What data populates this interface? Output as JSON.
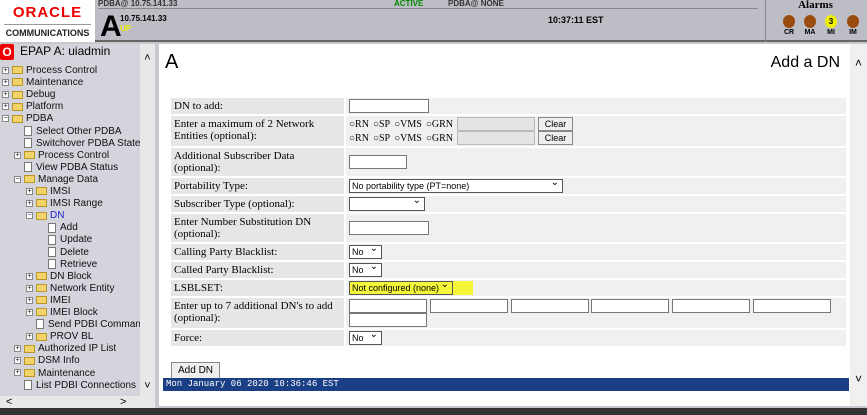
{
  "header": {
    "strip_left": "PDBA@ 10.75.141.33",
    "strip_status": "ACTIVE",
    "strip_right": "PDBA@ NONE",
    "logo_top": "ORACLE",
    "logo_bottom": "COMMUNICATIONS",
    "server": "A",
    "ip": "10.75.141.33",
    "state": "UP",
    "time": "10:37:11 EST"
  },
  "alarms": {
    "title": "Alarms",
    "items": [
      {
        "label": "CR",
        "count": ""
      },
      {
        "label": "MA",
        "count": ""
      },
      {
        "label": "MI",
        "count": "3"
      },
      {
        "label": "IM",
        "count": ""
      }
    ]
  },
  "sidebar": {
    "user": "EPAP A: uiadmin",
    "items": [
      "Process Control",
      "Maintenance",
      "Debug",
      "Platform",
      "PDBA",
      "Select Other PDBA",
      "Switchover PDBA State",
      "Process Control",
      "View PDBA Status",
      "Manage Data",
      "IMSI",
      "IMSI Range",
      "DN",
      "Add",
      "Update",
      "Delete",
      "Retrieve",
      "DN Block",
      "Network Entity",
      "IMEI",
      "IMEI Block",
      "Send PDBI Command",
      "PROV BL",
      "Authorized IP List",
      "DSM Info",
      "Maintenance",
      "List PDBI Connections"
    ]
  },
  "main": {
    "title": "A",
    "subtitle": "Add a DN",
    "labels": {
      "dn": "DN to add:",
      "ne": "Enter a maximum of 2 Network Entities (optional):",
      "asd": "Additional Subscriber Data (optional):",
      "pt": "Portability Type:",
      "st": "Subscriber Type (optional):",
      "nsdn": "Enter Number Substitution DN (optional):",
      "cgbl": "Calling Party Blacklist:",
      "cdbl": "Called Party Blacklist:",
      "lsblset": "LSBLSET:",
      "more": "Enter up to 7 additional DN's to add (optional):",
      "force": "Force:"
    },
    "radios": [
      "RN",
      "SP",
      "VMS",
      "GRN"
    ],
    "clear": "Clear",
    "values": {
      "pt": "No portability type (PT=none)",
      "st": "",
      "cgbl": "No",
      "cdbl": "No",
      "lsblset": "Not configured (none)",
      "force": "No"
    },
    "add_button": "Add DN",
    "status": "Mon January 06 2020 10:36:46 EST"
  },
  "colors": {
    "highlight": "#f5f53a",
    "status_bar": "#1b3f85"
  }
}
